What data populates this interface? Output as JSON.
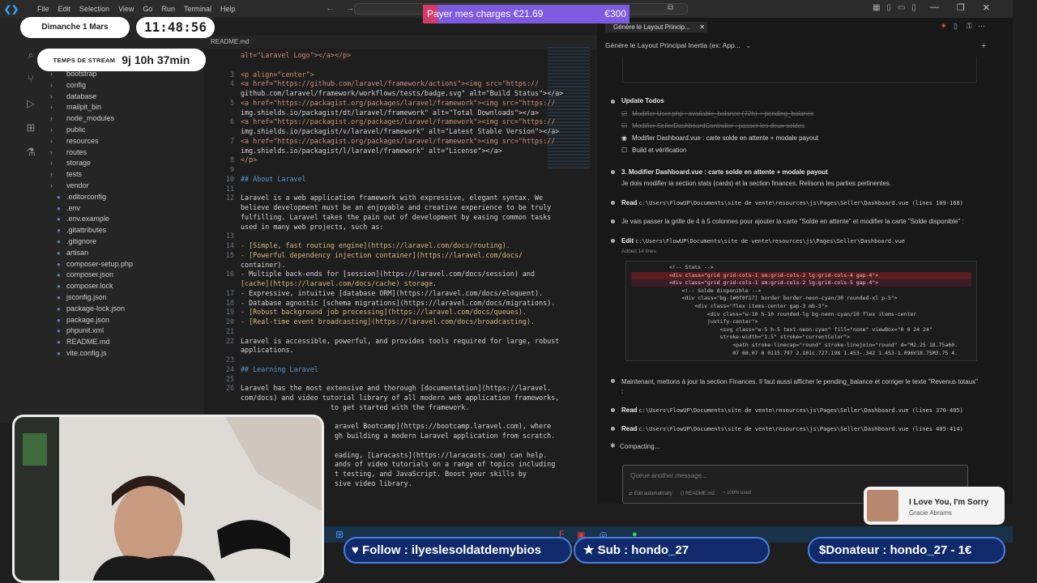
{
  "titlebar": {
    "menu": [
      "File",
      "Edit",
      "Selection",
      "View",
      "Go",
      "Run",
      "Terminal",
      "Help"
    ]
  },
  "stream": {
    "date": "Dimanche 1 Mars",
    "time": "11:48:56",
    "stream_label": "TEMPS DE STREAM",
    "stream_time": "9j 10h 37min",
    "charges_label": "Payer mes charges €21.69",
    "charges_goal": "€300"
  },
  "explorer": {
    "items": [
      {
        "label": "bootstrap",
        "type": "folder"
      },
      {
        "label": "config",
        "type": "folder"
      },
      {
        "label": "database",
        "type": "folder"
      },
      {
        "label": "mailpit_bin",
        "type": "folder"
      },
      {
        "label": "node_modules",
        "type": "folder"
      },
      {
        "label": "public",
        "type": "folder"
      },
      {
        "label": "resources",
        "type": "folder"
      },
      {
        "label": "routes",
        "type": "folder"
      },
      {
        "label": "storage",
        "type": "folder"
      },
      {
        "label": "tests",
        "type": "folder"
      },
      {
        "label": "vendor",
        "type": "folder"
      },
      {
        "label": ".editorconfig",
        "type": "file"
      },
      {
        "label": ".env",
        "type": "file"
      },
      {
        "label": ".env.example",
        "type": "file"
      },
      {
        "label": ".gitattributes",
        "type": "file"
      },
      {
        "label": ".gitignore",
        "type": "file"
      },
      {
        "label": "artisan",
        "type": "file"
      },
      {
        "label": "composer-setup.php",
        "type": "file"
      },
      {
        "label": "composer.json",
        "type": "file"
      },
      {
        "label": "composer.lock",
        "type": "file"
      },
      {
        "label": "jsconfig.json",
        "type": "file"
      },
      {
        "label": "package-lock.json",
        "type": "file"
      },
      {
        "label": "package.json",
        "type": "file"
      },
      {
        "label": "phpunit.xml",
        "type": "file"
      },
      {
        "label": "README.md",
        "type": "file"
      },
      {
        "label": "vite.config.js",
        "type": "file"
      }
    ]
  },
  "editor": {
    "tab": "README.md",
    "breadcrumb": "README.md",
    "lines": [
      {
        "n": "",
        "t": "alt=\"Laravel Logo\"></a></p>"
      },
      {
        "n": "",
        "t": ""
      },
      {
        "n": "3",
        "t": "<p align=\"center\">"
      },
      {
        "n": "4",
        "t": "<a href=\"https://github.com/laravel/framework/actions\"><img src=\"https://"
      },
      {
        "n": "",
        "t": "github.com/laravel/framework/workflows/tests/badge.svg\" alt=\"Build Status\"></a>"
      },
      {
        "n": "5",
        "t": "<a href=\"https://packagist.org/packages/laravel/framework\"><img src=\"https://"
      },
      {
        "n": "",
        "t": "img.shields.io/packagist/dt/laravel/framework\" alt=\"Total Downloads\"></a>"
      },
      {
        "n": "6",
        "t": "<a href=\"https://packagist.org/packages/laravel/framework\"><img src=\"https://"
      },
      {
        "n": "",
        "t": "img.shields.io/packagist/v/laravel/framework\" alt=\"Latest Stable Version\"></a>"
      },
      {
        "n": "7",
        "t": "<a href=\"https://packagist.org/packages/laravel/framework\"><img src=\"https://"
      },
      {
        "n": "",
        "t": "img.shields.io/packagist/l/laravel/framework\" alt=\"License\"></a>"
      },
      {
        "n": "8",
        "t": "</p>"
      },
      {
        "n": "9",
        "t": ""
      },
      {
        "n": "10",
        "t": "## About Laravel"
      },
      {
        "n": "11",
        "t": ""
      },
      {
        "n": "12",
        "t": "Laravel is a web application framework with expressive, elegant syntax. We"
      },
      {
        "n": "",
        "t": "believe development must be an enjoyable and creative experience to be truly"
      },
      {
        "n": "",
        "t": "fulfilling. Laravel takes the pain out of development by easing common tasks"
      },
      {
        "n": "",
        "t": "used in many web projects, such as:"
      },
      {
        "n": "13",
        "t": ""
      },
      {
        "n": "14",
        "t": "- [Simple, fast routing engine](https://laravel.com/docs/routing)."
      },
      {
        "n": "15",
        "t": "- [Powerful dependency injection container](https://laravel.com/docs/"
      },
      {
        "n": "",
        "t": "container)."
      },
      {
        "n": "16",
        "t": "- Multiple back-ends for [session](https://laravel.com/docs/session) and"
      },
      {
        "n": "",
        "t": "[cache](https://laravel.com/docs/cache) storage."
      },
      {
        "n": "17",
        "t": "- Expressive, intuitive [database ORM](https://laravel.com/docs/eloquent)."
      },
      {
        "n": "18",
        "t": "- Database agnostic [schema migrations](https://laravel.com/docs/migrations)."
      },
      {
        "n": "19",
        "t": "- [Robust background job processing](https://laravel.com/docs/queues)."
      },
      {
        "n": "20",
        "t": "- [Real-time event broadcasting](https://laravel.com/docs/broadcasting)."
      },
      {
        "n": "21",
        "t": ""
      },
      {
        "n": "22",
        "t": "Laravel is accessible, powerful, and provides tools required for large, robust"
      },
      {
        "n": "",
        "t": "applications."
      },
      {
        "n": "23",
        "t": ""
      },
      {
        "n": "24",
        "t": "## Learning Laravel"
      },
      {
        "n": "25",
        "t": ""
      },
      {
        "n": "26",
        "t": "Laravel has the most extensive and thorough [documentation](https://laravel."
      },
      {
        "n": "",
        "t": "com/docs) and video tutorial library of all modern web application frameworks,"
      },
      {
        "n": "",
        "t": "                      to get started with the framework."
      },
      {
        "n": "",
        "t": ""
      },
      {
        "n": "",
        "t": "                       aravel Bootcamp](https://bootcamp.laravel.com), where"
      },
      {
        "n": "",
        "t": "                       gh building a modern Laravel application from scratch."
      },
      {
        "n": "",
        "t": ""
      },
      {
        "n": "",
        "t": "                       eading, [Laracasts](https://laracasts.com) can help."
      },
      {
        "n": "",
        "t": "                       ands of video tutorials on a range of topics including"
      },
      {
        "n": "",
        "t": "                       t testing, and JavaScript. Boost your skills by"
      },
      {
        "n": "",
        "t": "                       sive video library."
      }
    ]
  },
  "chat": {
    "tab_title": "Génère le Layout Princip...",
    "subtitle": "Génère le Layout Principal Inertia (ex: App...",
    "update_todos": "Update Todos",
    "todos": [
      {
        "label": "Modifier User.php : available_balance (72h) + pending_balance",
        "state": "done"
      },
      {
        "label": "Modifier SellerDashboardController : passer les deux soldes",
        "state": "done"
      },
      {
        "label": "Modifier Dashboard.vue : carte solde en attente + modale payout",
        "state": "active"
      },
      {
        "label": "Build et vérification",
        "state": "todo"
      }
    ],
    "step_title": "3. Modifier Dashboard.vue : carte solde en attente + modale payout",
    "step_desc": "Je dois modifier la section stats (cards) et la section finances. Relisons les parties pertinentes.",
    "read1_label": "Read",
    "read1_path": "c:\\Users\\FlowUP\\Documents\\site de vente\\resources\\js\\Pages\\Seller\\Dashboard.vue (lines 109-168)",
    "msg1": "Je vais passer la grille de 4 à 5 colonnes pour ajouter la carte \"Solde en attente\" et modifier la carte \"Solde disponible\" :",
    "edit_label": "Edit",
    "edit_path": "c:\\Users\\FlowUP\\Documents\\site de vente\\resources\\js\\Pages\\Seller\\Dashboard.vue",
    "edit_added": "Added 14 lines",
    "diff_lines": [
      {
        "t": "            <!-- Stats -->",
        "kind": "ctx"
      },
      {
        "t": "            <div class=\"grid grid-cols-1 sm:grid-cols-2 lg:grid-cols-4 gap-4\">",
        "kind": "del"
      },
      {
        "t": "            <div class=\"grid grid-cols-1 sm:grid-cols-2 lg:grid-cols-5 gap-4\">",
        "kind": "add"
      },
      {
        "t": "                <!-- Solde disponible -->",
        "kind": "ctx"
      },
      {
        "t": "                <div class=\"bg-[#0f0f17] border border-neon-cyan/30 rounded-xl p-5\">",
        "kind": "ctx"
      },
      {
        "t": "                    <div class=\"flex items-center gap-3 mb-3\">",
        "kind": "ctx"
      },
      {
        "t": "                        <div class=\"w-10 h-10 rounded-lg bg-neon-cyan/10 flex items-center",
        "kind": "ctx"
      },
      {
        "t": "                        justify-center\">",
        "kind": "ctx"
      },
      {
        "t": "                            <svg class=\"w-5 h-5 text-neon-cyan\" fill=\"none\" viewBox=\"0 0 24 24\"",
        "kind": "ctx"
      },
      {
        "t": "                            stroke-width=\"1.5\" stroke=\"currentColor\">",
        "kind": "ctx"
      },
      {
        "t": "                                <path stroke-linecap=\"round\" stroke-linejoin=\"round\" d=\"M2.25 18.75a60.",
        "kind": "ctx"
      },
      {
        "t": "                                07 60.07 0 0115.797 2.101c.727.198 1.453-.342 1.453-1.096V18.75M3.75 4.",
        "kind": "ctx"
      }
    ],
    "msg2": "Maintenant, mettons à jour la section Finances. Il faut aussi afficher le pending_balance et corriger le texte \"Revenus totaux\" :",
    "read2_label": "Read",
    "read2_path": "c:\\Users\\FlowUP\\Documents\\site de vente\\resources\\js\\Pages\\Seller\\Dashboard.vue (lines 376-405)",
    "read3_label": "Read",
    "read3_path": "c:\\Users\\FlowUP\\Documents\\site de vente\\resources\\js\\Pages\\Seller\\Dashboard.vue (lines 405-414)",
    "compacting": "Compacting...",
    "input_placeholder": "Queue another message...",
    "input_footer": {
      "mode": "Edit automatically",
      "file": "README.md",
      "usage": "100% used"
    }
  },
  "overlays": {
    "song_title": "I Love You, I'm Sorry",
    "song_artist": "Gracie Abrams",
    "follow": "Follow : ilyeslesoldatdemybios",
    "sub": "Sub : hondo_27",
    "donateur": "Donateur : hondo_27 - 1€"
  }
}
